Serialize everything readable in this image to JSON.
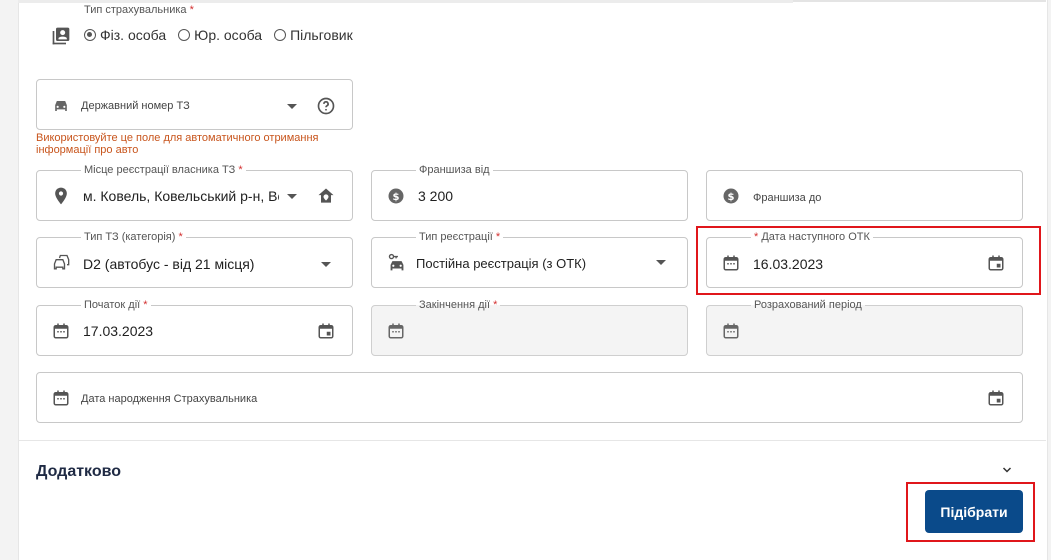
{
  "insurer_type": {
    "label": "Тип страхувальника",
    "required_mark": "*",
    "options": [
      {
        "label": "Фіз. особа",
        "selected": true
      },
      {
        "label": "Юр. особа",
        "selected": false
      },
      {
        "label": "Пільговик",
        "selected": false
      }
    ]
  },
  "plate": {
    "placeholder": "Державний номер ТЗ",
    "hint": "Використовуйте це поле для автоматичного отримання інформації про авто"
  },
  "registration_place": {
    "label": "Місце реєстрації власника ТЗ",
    "required_mark": "*",
    "value": "м. Ковель, Ковельський р-н, Во"
  },
  "franchise_from": {
    "label": "Франшиза від",
    "value": "3 200"
  },
  "franchise_to": {
    "placeholder": "Франшиза до"
  },
  "vehicle_type": {
    "label": "Тип ТЗ (категорія)",
    "required_mark": "*",
    "value": "D2 (автобус - від 21 місця)"
  },
  "registration_type": {
    "label": "Тип реєстрації",
    "required_mark": "*",
    "value": "Постійна реєстрація (з ОТК)"
  },
  "next_otk": {
    "label": "Дата наступного ОТК",
    "required_mark": "*",
    "value": "16.03.2023"
  },
  "start_date": {
    "label": "Початок дії",
    "required_mark": "*",
    "value": "17.03.2023"
  },
  "end_date": {
    "label": "Закінчення дії",
    "required_mark": "*",
    "value": ""
  },
  "period": {
    "label": "Розрахований період",
    "value": ""
  },
  "birth_date": {
    "placeholder": "Дата народження Страхувальника"
  },
  "additional": {
    "title": "Додатково"
  },
  "submit": {
    "label": "Підібрати"
  },
  "colors": {
    "primary": "#0a4a8a",
    "hint": "#c8551d",
    "required": "#d32f2f",
    "highlight": "#e0161b"
  }
}
